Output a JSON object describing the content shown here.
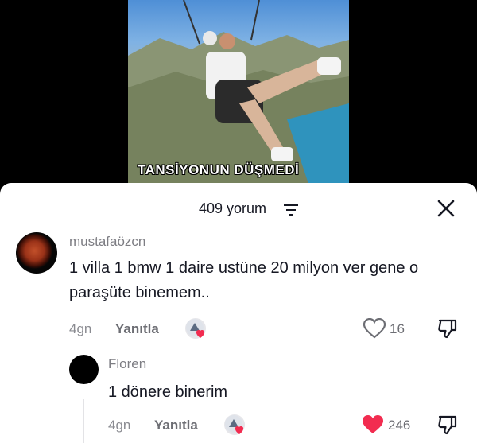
{
  "video": {
    "caption": "TANSİYONUN DÜŞMEDİ"
  },
  "sheet": {
    "comment_count": "409 yorum"
  },
  "comments": [
    {
      "username": "mustafaözcn",
      "text": "1 villa 1 bmw 1 daire ustüne 20 milyon ver gene o paraşüte binemem..",
      "time": "4gn",
      "reply_label": "Yanıtla",
      "likes": "16",
      "liked": false
    },
    {
      "username": "Floren",
      "text": "1 dönere binerim",
      "time": "4gn",
      "reply_label": "Yanıtla",
      "likes": "246",
      "liked": true
    }
  ],
  "colors": {
    "like_active": "#f22c50",
    "text": "#161823",
    "muted": "#8a8b91"
  }
}
